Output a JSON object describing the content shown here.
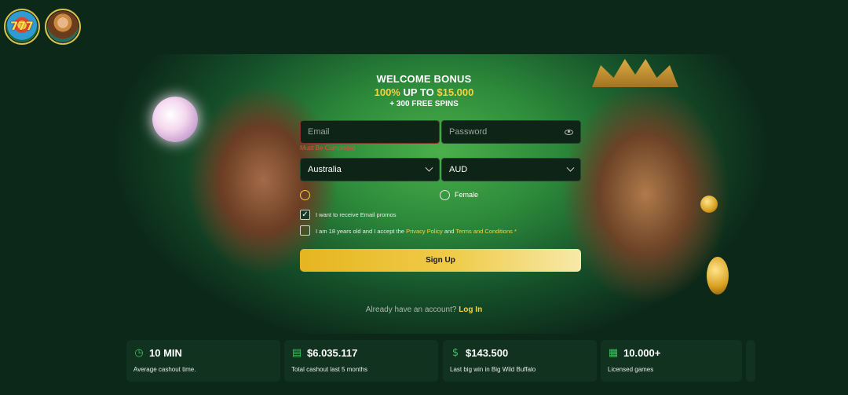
{
  "top_games": [
    {
      "name": "777 slot game"
    },
    {
      "name": "Goddess slot game"
    }
  ],
  "bonus": {
    "title": "WELCOME BONUS",
    "percent": "100%",
    "up_to": "UP TO",
    "amount": "$15.000",
    "spins": "+ 300 FREE SPINS"
  },
  "form": {
    "email_placeholder": "Email",
    "password_placeholder": "Password",
    "email_error": "Must Be Completed",
    "country_value": "Australia",
    "currency_value": "AUD",
    "gender_options": [
      "",
      "Female"
    ],
    "promo_label": "I want to receive Email promos",
    "terms_prefix": "I am 18 years old and I accept the",
    "privacy_link": "Privacy Policy",
    "and": "and",
    "terms_link": "Terms and Conditions",
    "required_mark": "*",
    "signup_label": "Sign Up",
    "have_account": "Already have an account?",
    "login_link": "Log In"
  },
  "stats": [
    {
      "icon": "stopwatch-icon",
      "value": "10 MIN",
      "label": "Average cashout time."
    },
    {
      "icon": "money-stack-icon",
      "value": "$6.035.117",
      "label": "Total cashout last 5 months"
    },
    {
      "icon": "money-bag-icon",
      "value": "$143.500",
      "label": "Last big win in Big Wild Buffalo"
    },
    {
      "icon": "slot-machine-icon",
      "value": "10.000+",
      "label": "Licensed games"
    }
  ],
  "colors": {
    "accent": "#f5d243",
    "background": "#0c2818",
    "error": "#e0503c",
    "stat_icon": "#3fbf63"
  }
}
